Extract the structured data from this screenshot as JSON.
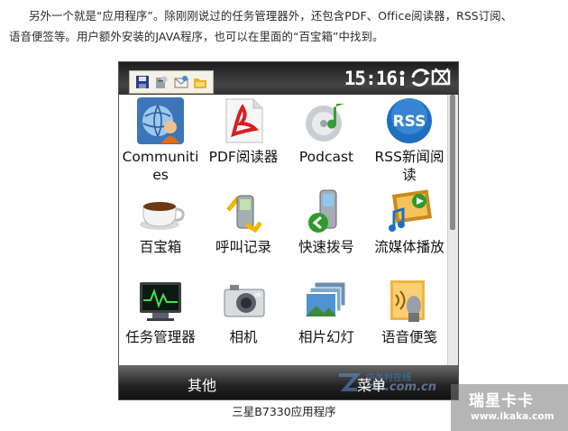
{
  "article": {
    "line1": "另外一个就是“应用程序”。除刚刚说过的任务管理器外，还包含PDF、Office阅读器，RSS订阅、",
    "line2": "语音便签等。用户额外安装的JAVA程序，也可以在里面的“百宝箱”中找到。",
    "caption": "三星B7330应用程序"
  },
  "phone": {
    "status": {
      "time": "15:16"
    },
    "quickbar_icons": [
      "save-icon",
      "tools-icon",
      "mail-icon",
      "folder-icon"
    ],
    "apps": [
      {
        "label": "Communities",
        "icon": "communities-icon"
      },
      {
        "label": "PDF阅读器",
        "icon": "pdf-icon"
      },
      {
        "label": "Podcast",
        "icon": "podcast-icon"
      },
      {
        "label": "RSS新闻阅读",
        "icon": "rss-icon",
        "icon_text": "RSS"
      },
      {
        "label": "百宝箱",
        "icon": "toolbox-icon"
      },
      {
        "label": "呼叫记录",
        "icon": "call-log-icon"
      },
      {
        "label": "快速拨号",
        "icon": "speed-dial-icon"
      },
      {
        "label": "流媒体播放",
        "icon": "streaming-icon"
      },
      {
        "label": "任务管理器",
        "icon": "task-manager-icon"
      },
      {
        "label": "相机",
        "icon": "camera-icon"
      },
      {
        "label": "相片幻灯",
        "icon": "slideshow-icon"
      },
      {
        "label": "语音便笺",
        "icon": "voice-note-icon"
      }
    ],
    "softkeys": {
      "left": "其他",
      "right": "菜单"
    },
    "watermark": {
      "line1": "中关村在线",
      "line2": "zol.com.cn"
    }
  },
  "site_watermark": {
    "line1": "瑞星卡卡",
    "line2": "www.ikaka.com"
  },
  "colors": {
    "status_bg": "#2a2a2a",
    "softbar_bg": "#1a1a1a",
    "rss_blue": "#1f6fc0"
  }
}
